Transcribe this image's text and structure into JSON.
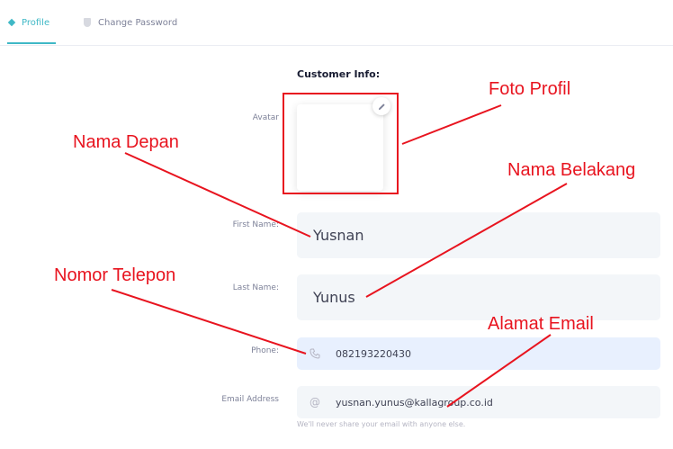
{
  "tabs": [
    {
      "label": "Profile",
      "icon": "diamond-icon",
      "active": true
    },
    {
      "label": "Change Password",
      "icon": "shield-icon",
      "active": false
    }
  ],
  "form": {
    "section_title": "Customer Info:",
    "avatar_label": "Avatar",
    "first_name_label": "First Name:",
    "first_name_value": "Yusnan",
    "last_name_label": "Last Name:",
    "last_name_value": "Yunus",
    "phone_label": "Phone:",
    "phone_value": "082193220430",
    "email_label": "Email Address",
    "email_value": "yusnan.yunus@kallagroup.co.id",
    "email_hint": "We'll never share your email with anyone else."
  },
  "annotations": {
    "foto_profil": "Foto Profil",
    "nama_depan": "Nama Depan",
    "nama_belakang": "Nama Belakang",
    "nomor_telepon": "Nomor Telepon",
    "alamat_email": "Alamat Email"
  },
  "colors": {
    "accent": "#3fb8c6",
    "annotation": "#e8141f",
    "input_bg": "#f3f6f9",
    "autofill_bg": "#e8f0fe"
  }
}
